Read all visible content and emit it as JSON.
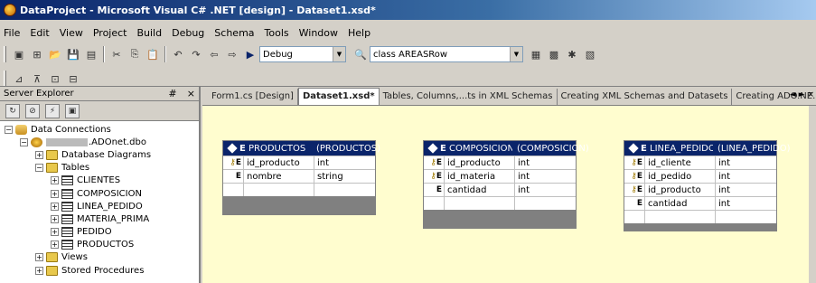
{
  "window": {
    "title": "DataProject - Microsoft Visual C# .NET [design] - Dataset1.xsd*"
  },
  "menu": [
    "File",
    "Edit",
    "View",
    "Project",
    "Build",
    "Debug",
    "Schema",
    "Tools",
    "Window",
    "Help"
  ],
  "toolbar": {
    "config_value": "Debug",
    "class_value": "class AREASRow"
  },
  "server_explorer": {
    "title": "Server Explorer",
    "pin": "#",
    "close": "×",
    "tree": [
      {
        "label": "Data Connections",
        "depth": 0,
        "expander": "−",
        "icon": "database-icon"
      },
      {
        "label": ".ADOnet.dbo",
        "depth": 1,
        "expander": "−",
        "icon": "server-icon"
      },
      {
        "label": "Database Diagrams",
        "depth": 2,
        "expander": "+",
        "icon": "folder-icon"
      },
      {
        "label": "Tables",
        "depth": 2,
        "expander": "−",
        "icon": "folder-icon"
      },
      {
        "label": "CLIENTES",
        "depth": 3,
        "expander": "+",
        "icon": "table-icon"
      },
      {
        "label": "COMPOSICION",
        "depth": 3,
        "expander": "+",
        "icon": "table-icon"
      },
      {
        "label": "LINEA_PEDIDO",
        "depth": 3,
        "expander": "+",
        "icon": "table-icon"
      },
      {
        "label": "MATERIA_PRIMA",
        "depth": 3,
        "expander": "+",
        "icon": "table-icon"
      },
      {
        "label": "PEDIDO",
        "depth": 3,
        "expander": "+",
        "icon": "table-icon"
      },
      {
        "label": "PRODUCTOS",
        "depth": 3,
        "expander": "+",
        "icon": "table-icon"
      },
      {
        "label": "Views",
        "depth": 2,
        "expander": "+",
        "icon": "folder-icon"
      },
      {
        "label": "Stored Procedures",
        "depth": 2,
        "expander": "+",
        "icon": "folder-icon"
      }
    ]
  },
  "tabs": [
    {
      "label": "Form1.cs [Design]",
      "active": false
    },
    {
      "label": "Dataset1.xsd*",
      "active": true
    },
    {
      "label": "Tables, Columns,...ts in XML Schemas",
      "active": false
    },
    {
      "label": "Creating XML Schemas and Datasets",
      "active": false
    },
    {
      "label": "Creating ADO.NE...ts from Sc",
      "active": false
    }
  ],
  "tab_nav": "◄ ► ×",
  "schema_tables": [
    {
      "name": "PRODUCTOS",
      "type": "(PRODUCTOS)",
      "rows": [
        {
          "mark": "E",
          "key": true,
          "name": "id_producto",
          "type": "int"
        },
        {
          "mark": "E",
          "key": false,
          "name": "nombre",
          "type": "string"
        },
        {
          "mark": "",
          "key": false,
          "name": "",
          "type": ""
        }
      ]
    },
    {
      "name": "COMPOSICION",
      "type": "(COMPOSICION)",
      "rows": [
        {
          "mark": "E",
          "key": true,
          "name": "id_producto",
          "type": "int"
        },
        {
          "mark": "E",
          "key": true,
          "name": "id_materia",
          "type": "int"
        },
        {
          "mark": "E",
          "key": false,
          "name": "cantidad",
          "type": "int"
        },
        {
          "mark": "",
          "key": false,
          "name": "",
          "type": ""
        }
      ]
    },
    {
      "name": "LINEA_PEDIDO",
      "type": "(LINEA_PEDIDO)",
      "rows": [
        {
          "mark": "E",
          "key": true,
          "name": "id_cliente",
          "type": "int"
        },
        {
          "mark": "E",
          "key": true,
          "name": "id_pedido",
          "type": "int"
        },
        {
          "mark": "E",
          "key": true,
          "name": "id_producto",
          "type": "int"
        },
        {
          "mark": "E",
          "key": false,
          "name": "cantidad",
          "type": "int"
        },
        {
          "mark": "",
          "key": false,
          "name": "",
          "type": ""
        }
      ]
    }
  ]
}
